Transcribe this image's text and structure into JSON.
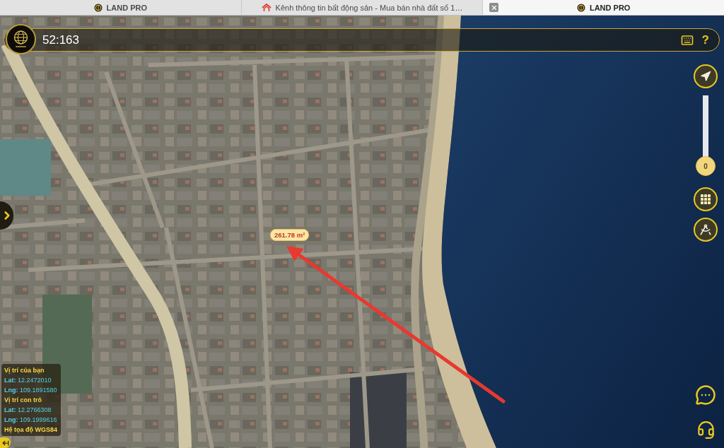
{
  "browser_tabs": [
    {
      "kind": "landpro",
      "title": "LAND PRO",
      "selected": false
    },
    {
      "kind": "batdongsan",
      "title": "Kênh thông tin bất động sản - Mua bán nhà đất số 1…",
      "selected": false
    },
    {
      "kind": "landpro",
      "title": "LAND PRO",
      "selected": true
    }
  ],
  "search_bar": {
    "value": "52:163",
    "help_label": "?"
  },
  "zoom_slider": {
    "value_label": "0",
    "level": 0
  },
  "area_label": "261.78 m²",
  "location_panel": [
    {
      "kind": "heading",
      "text": "Vị trí của bạn"
    },
    {
      "kind": "coordinate",
      "text": "**Lat:** 12.2472010"
    },
    {
      "kind": "coordinate",
      "text": "**Lng:** 109.1891580"
    },
    {
      "kind": "heading",
      "text": "Vị trí con trỏ"
    },
    {
      "kind": "coordinate",
      "text": "**Lat:** 12.2766308"
    },
    {
      "kind": "coordinate",
      "text": "**Lng:** 109.1999616"
    },
    {
      "kind": "heading",
      "text": "Hệ tọa độ WGS84"
    }
  ]
}
